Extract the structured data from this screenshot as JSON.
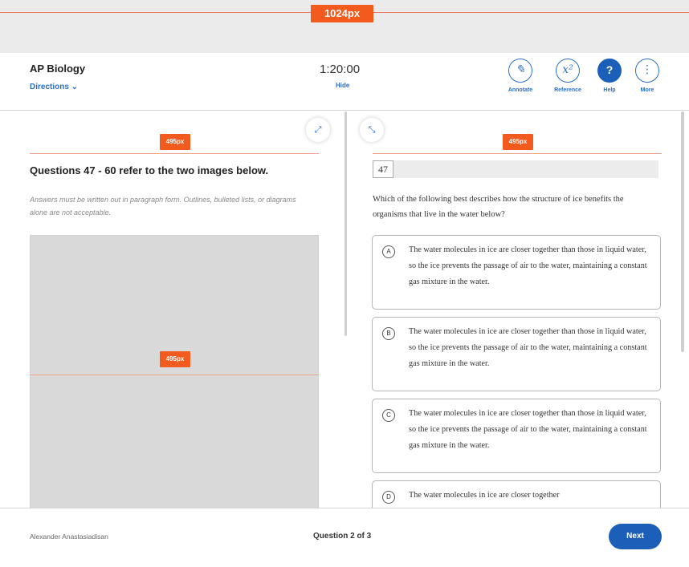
{
  "rulers": {
    "page_width_label": "1024px",
    "left_pane_label": "495px",
    "right_pane_label": "495px",
    "image_label": "495px"
  },
  "header": {
    "course_title": "AP Biology",
    "directions_label": "Directions ⌄",
    "timer": "1:20:00",
    "hide_label": "Hide",
    "tools": [
      {
        "label": "Annotate",
        "icon": "✎"
      },
      {
        "label": "Reference",
        "icon": "x²"
      },
      {
        "label": "Help",
        "icon": "?"
      },
      {
        "label": "More",
        "icon": "⋮"
      }
    ]
  },
  "passage": {
    "title": "Questions 47 - 60 refer to the two images below.",
    "note": "Answers must be written out in paragraph form. Outlines, bulleted lists, or diagrams alone are not acceptable."
  },
  "question": {
    "number": "47",
    "text": "Which of the following best describes how the structure of ice benefits the organisms that live in the water below?",
    "choices": [
      {
        "letter": "A",
        "text": "The water molecules in ice are closer together than those in liquid water, so the ice prevents the passage of air to the water, maintaining a constant gas mixture in the water."
      },
      {
        "letter": "B",
        "text": "The water molecules in ice are closer together than those in liquid water, so the ice prevents the passage of air to the water, maintaining a constant gas mixture in the water."
      },
      {
        "letter": "C",
        "text": "The water molecules in ice are closer together than those in liquid water, so the ice prevents the passage of air to the water, maintaining a constant gas mixture in the water."
      },
      {
        "letter": "D",
        "text": "The water molecules in ice are closer together"
      }
    ]
  },
  "footer": {
    "student_name": "Alexander Anastasiadisan",
    "question_count": "Question 2 of 3",
    "next_label": "Next"
  },
  "colors": {
    "accent": "#1b5fb8",
    "ruler": "#f25a1e",
    "guide": "#f2a58c"
  }
}
